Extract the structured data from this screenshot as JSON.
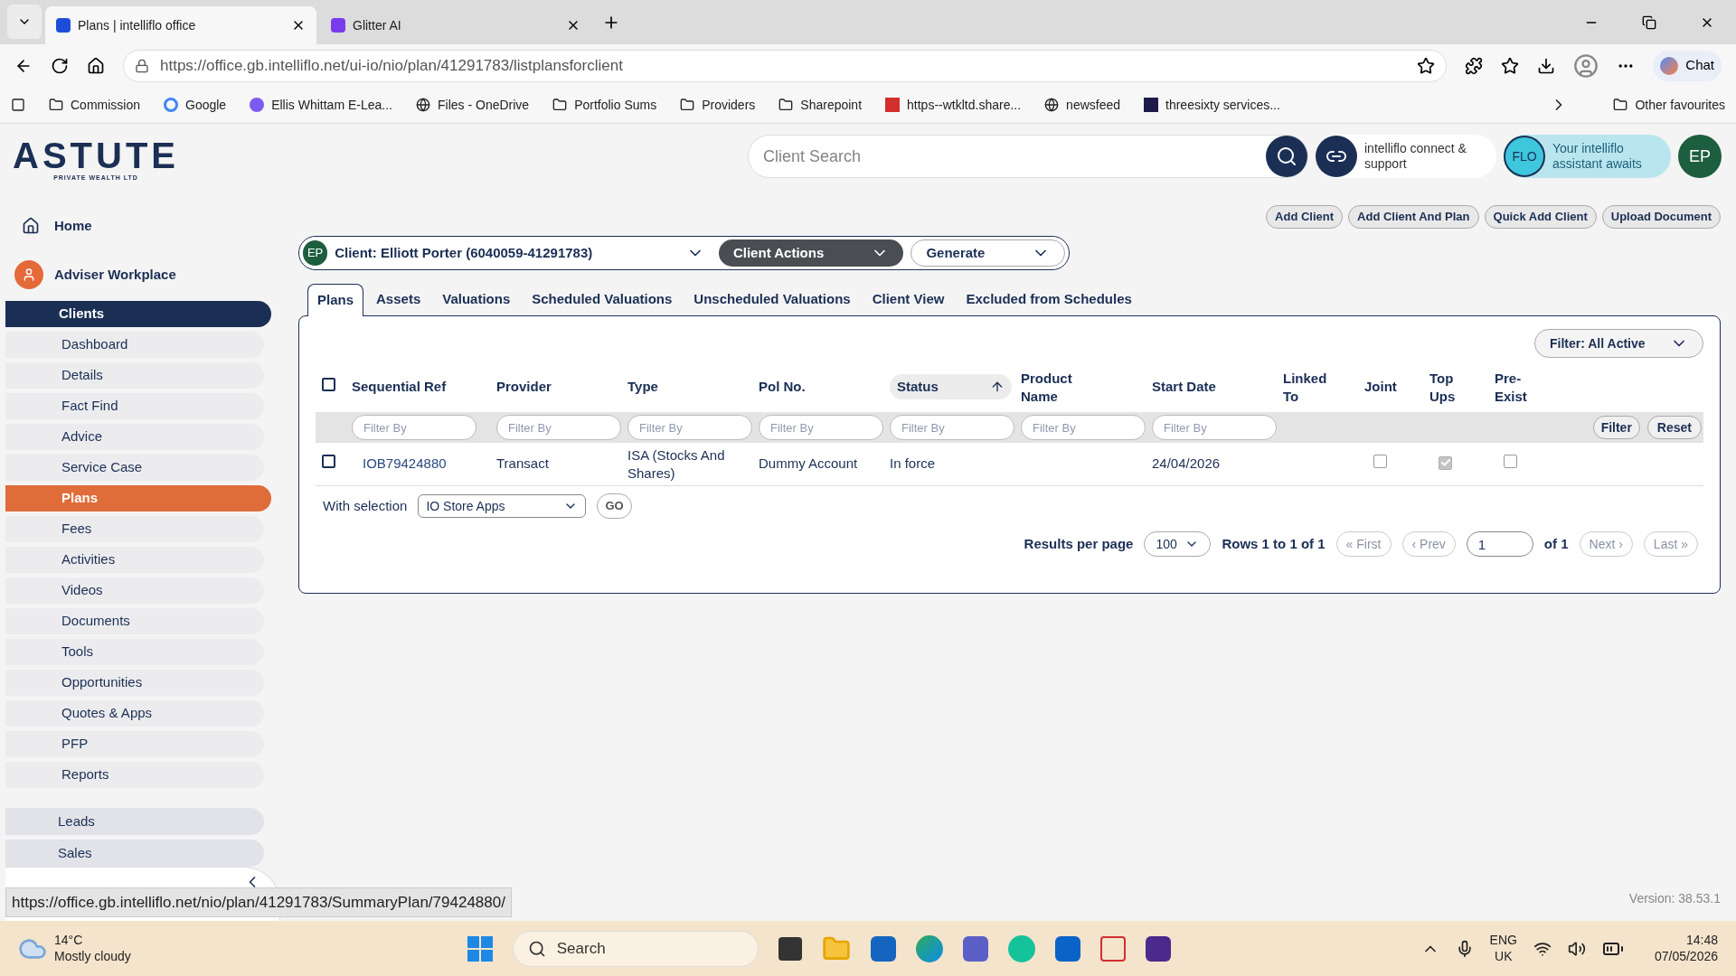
{
  "browser": {
    "tabs": [
      {
        "title": "Plans | intelliflo office",
        "selected": true
      },
      {
        "title": "Glitter AI",
        "selected": false
      }
    ],
    "url": "https://office.gb.intelliflo.net/ui-io/nio/plan/41291783/listplansforclient",
    "chat": "Chat",
    "bookmarks": [
      "Commission",
      "Google",
      "Ellis Whittam E-Lea...",
      "Files - OneDrive",
      "Portfolio Sums",
      "Providers",
      "Sharepoint",
      "https--wtkltd.share...",
      "newsfeed",
      "threesixty services..."
    ],
    "other_favourites": "Other favourites"
  },
  "header": {
    "logo": "ASTUTE",
    "logo_tagline": "PRIVATE WEALTH LTD",
    "search_placeholder": "Client Search",
    "connect": "intelliflo connect & support",
    "flo_badge": "FLO",
    "flo": "Your intelliflo assistant awaits",
    "avatar": "EP"
  },
  "sidebar": {
    "home": "Home",
    "workplace": "Adviser Workplace",
    "group": "Clients",
    "items": [
      {
        "label": "Dashboard",
        "selected": false
      },
      {
        "label": "Details",
        "selected": false
      },
      {
        "label": "Fact Find",
        "selected": false
      },
      {
        "label": "Advice",
        "selected": false
      },
      {
        "label": "Service Case",
        "selected": false
      },
      {
        "label": "Plans",
        "selected": true
      },
      {
        "label": "Fees",
        "selected": false
      },
      {
        "label": "Activities",
        "selected": false
      },
      {
        "label": "Videos",
        "selected": false
      },
      {
        "label": "Documents",
        "selected": false
      },
      {
        "label": "Tools",
        "selected": false
      },
      {
        "label": "Opportunities",
        "selected": false
      },
      {
        "label": "Quotes & Apps",
        "selected": false
      },
      {
        "label": "PFP",
        "selected": false
      },
      {
        "label": "Reports",
        "selected": false
      }
    ],
    "sections": [
      "Leads",
      "Sales"
    ]
  },
  "top_buttons": [
    "Add Client",
    "Add Client And Plan",
    "Quick Add Client",
    "Upload Document"
  ],
  "client_bar": {
    "avatar": "EP",
    "client": "Client: Elliott Porter (6040059-41291783)",
    "actions": "Client Actions",
    "generate": "Generate"
  },
  "page_tabs": [
    {
      "label": "Plans",
      "selected": true
    },
    {
      "label": "Assets",
      "selected": false
    },
    {
      "label": "Valuations",
      "selected": false
    },
    {
      "label": "Scheduled Valuations",
      "selected": false
    },
    {
      "label": "Unscheduled Valuations",
      "selected": false
    },
    {
      "label": "Client View",
      "selected": false
    },
    {
      "label": "Excluded from Schedules",
      "selected": false
    }
  ],
  "filter_dropdown": "Filter: All Active",
  "table": {
    "select_all": false,
    "columns": [
      {
        "label": "Sequential Ref",
        "sorted": false,
        "filter_placeholder": "Filter By"
      },
      {
        "label": "Provider",
        "sorted": false,
        "filter_placeholder": "Filter By"
      },
      {
        "label": "Type",
        "sorted": false,
        "filter_placeholder": "Filter By"
      },
      {
        "label": "Pol No.",
        "sorted": false,
        "filter_placeholder": "Filter By"
      },
      {
        "label": "Status",
        "sorted": true,
        "filter_placeholder": "Filter By"
      },
      {
        "label": "Product Name",
        "sorted": false,
        "filter_placeholder": "Filter By"
      },
      {
        "label": "Start Date",
        "sorted": false,
        "filter_placeholder": "Filter By"
      },
      {
        "label": "Linked To",
        "sorted": false
      },
      {
        "label": "Joint",
        "sorted": false
      },
      {
        "label": "Top Ups",
        "sorted": false
      },
      {
        "label": "Pre-Exist",
        "sorted": false
      }
    ],
    "filter_button": "Filter",
    "reset_button": "Reset",
    "rows": [
      {
        "selected": false,
        "ref": "IOB79424880",
        "provider": "Transact",
        "type": "ISA (Stocks And Shares)",
        "pol_no": "Dummy Account",
        "status": "In force",
        "start_date": "24/04/2026",
        "joint": false,
        "top_ups": true,
        "pre_exist": false
      }
    ]
  },
  "with_selection": {
    "label": "With selection",
    "value": "IO Store Apps",
    "go": "GO"
  },
  "pagination": {
    "per_page_label": "Results per page",
    "per_page": "100",
    "rows": "Rows 1 to 1 of 1",
    "first": "« First",
    "prev": "‹ Prev",
    "page": "1",
    "of": "of 1",
    "next": "Next ›",
    "last": "Last »"
  },
  "version": "Version: 38.53.1",
  "status_url": "https://office.gb.intelliflo.net/nio/plan/41291783/SummaryPlan/79424880/",
  "taskbar": {
    "temp": "14°C",
    "weather": "Mostly cloudy",
    "search": "Search",
    "lang": "ENG",
    "region": "UK",
    "time": "14:48",
    "date": "07/05/2026"
  }
}
